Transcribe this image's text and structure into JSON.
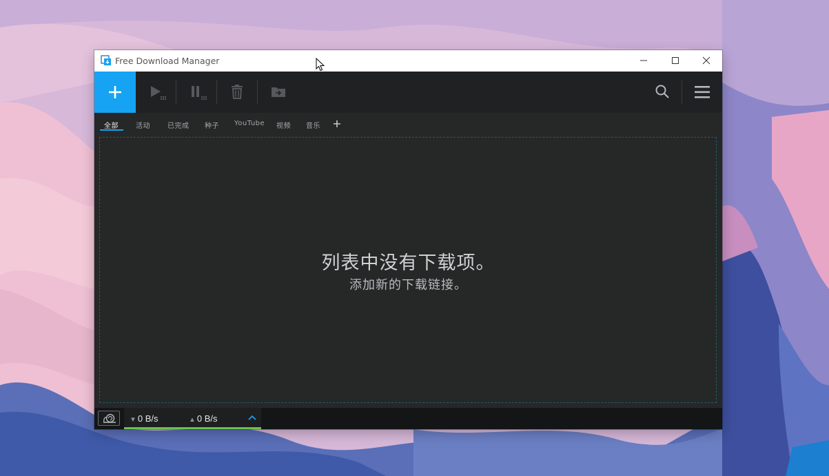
{
  "window": {
    "title": "Free Download Manager"
  },
  "toolbar": {
    "add": "plus-icon",
    "resume": "play-icon",
    "pause": "pause-icon",
    "delete": "trash-icon",
    "move": "folder-move-icon",
    "search": "search-icon",
    "menu": "hamburger-menu-icon"
  },
  "tabs": [
    {
      "label": "全部",
      "active": true
    },
    {
      "label": "活动",
      "active": false
    },
    {
      "label": "已完成",
      "active": false
    },
    {
      "label": "种子",
      "active": false
    },
    {
      "label": "YouTube",
      "active": false
    },
    {
      "label": "视频",
      "active": false
    },
    {
      "label": "音乐",
      "active": false
    }
  ],
  "empty_state": {
    "title": "列表中没有下载项。",
    "subtitle": "添加新的下载链接。"
  },
  "status": {
    "download_speed": "0 B/s",
    "upload_speed": "0 B/s"
  },
  "colors": {
    "accent": "#16a3f3",
    "toolbar_bg": "#1f2123",
    "content_bg": "#262727",
    "speed_bar": "#6cc24a"
  }
}
